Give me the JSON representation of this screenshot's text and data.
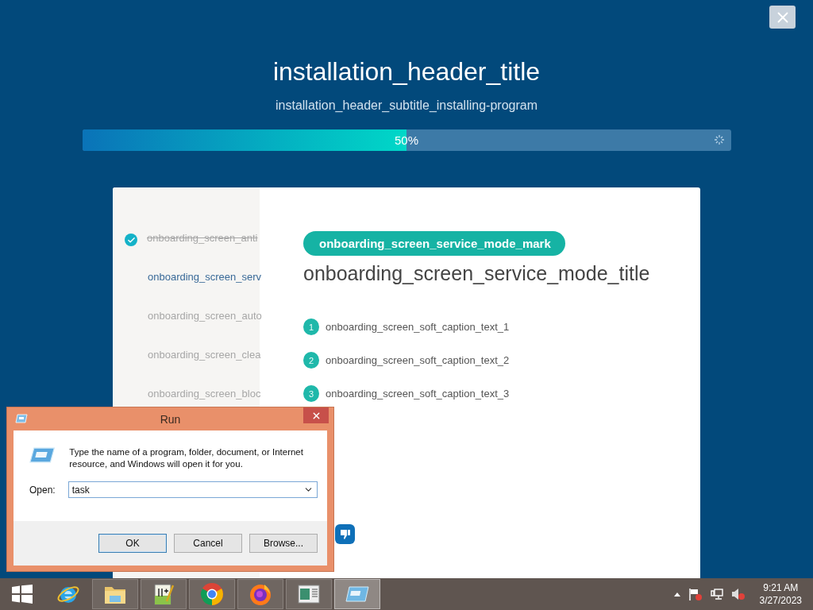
{
  "installer": {
    "title": "installation_header_title",
    "subtitle": "installation_header_subtitle_installing-program",
    "progress": {
      "level": 0.5,
      "reading": "50%"
    }
  },
  "steps": [
    {
      "label": "onboarding_screen_anti",
      "done": true,
      "selected": false
    },
    {
      "label": "onboarding_screen_serv",
      "done": false,
      "selected": true
    },
    {
      "label": "onboarding_screen_auto",
      "done": false,
      "selected": false
    },
    {
      "label": "onboarding_screen_clea",
      "done": false,
      "selected": false
    },
    {
      "label": "onboarding_screen_bloc",
      "done": false,
      "selected": false
    }
  ],
  "service_mode": {
    "mark": "onboarding_screen_service_mode_mark",
    "title": "onboarding_screen_service_mode_title",
    "captions": [
      {
        "number": "1",
        "text": "onboarding_screen_soft_caption_text_1"
      },
      {
        "number": "2",
        "text": "onboarding_screen_soft_caption_text_2"
      },
      {
        "number": "3",
        "text": "onboarding_screen_soft_caption_text_3"
      }
    ]
  },
  "run_dialog": {
    "title": "Run",
    "description": "Type the name of a program, folder, document, or Internet resource, and Windows will open it for you.",
    "open_label": "Open:",
    "value": "task",
    "buttons": [
      {
        "label": "OK",
        "selected": true
      },
      {
        "label": "Cancel",
        "selected": false
      },
      {
        "label": "Browse...",
        "selected": false
      }
    ]
  },
  "taskbar": {
    "apps": [
      {
        "kind": "start",
        "running": false,
        "selected": false
      },
      {
        "kind": "ie",
        "running": false,
        "selected": false
      },
      {
        "kind": "explorer",
        "running": true,
        "selected": false
      },
      {
        "kind": "notepad",
        "running": true,
        "selected": false
      },
      {
        "kind": "chrome",
        "running": true,
        "selected": false
      },
      {
        "kind": "firefox",
        "running": true,
        "selected": false
      },
      {
        "kind": "viewer",
        "running": true,
        "selected": false
      },
      {
        "kind": "run",
        "running": true,
        "selected": true
      }
    ],
    "time": "9:21 AM",
    "date": "3/27/2023"
  }
}
